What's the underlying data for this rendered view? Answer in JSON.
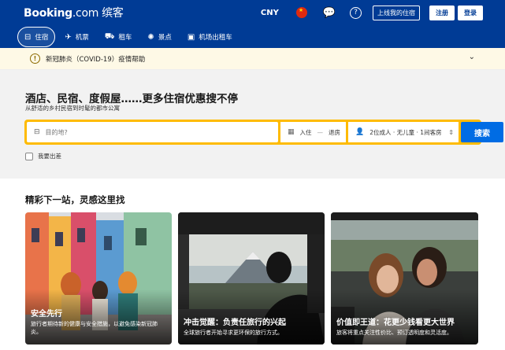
{
  "header": {
    "logo_brand": "Booking",
    "logo_dot": ".com",
    "logo_cn": "缤客",
    "currency": "CNY",
    "list_property": "上线我的住宿",
    "register": "注册",
    "login": "登录"
  },
  "nav": {
    "items": [
      {
        "label": "住宿",
        "icon": "bed-icon",
        "glyph": "🛏"
      },
      {
        "label": "机票",
        "icon": "plane-icon",
        "glyph": "✈"
      },
      {
        "label": "租车",
        "icon": "car-icon",
        "glyph": "🚗"
      },
      {
        "label": "景点",
        "icon": "attraction-icon",
        "glyph": "✺"
      },
      {
        "label": "机场出租车",
        "icon": "taxi-icon",
        "glyph": "▣"
      }
    ]
  },
  "alert": {
    "text": "新冠肺炎（COVID-19）疫情帮助"
  },
  "hero": {
    "title": "酒店、民宿、度假屋……更多住宿优惠搜不停",
    "subtitle": "从舒适的乡村民宿到时髦的都市公寓"
  },
  "search": {
    "destination_placeholder": "目的地?",
    "checkin": "入住",
    "checkout": "退房",
    "occupancy": "2位成人 · 无儿童 · 1间客房",
    "button": "搜索",
    "business_trip": "我要出差"
  },
  "inspiration": {
    "title": "精彩下一站，灵感这里找",
    "cards": [
      {
        "title": "安全先行",
        "desc_line1": "旅行者期待新的健康与安全措施，以避免感染新冠肺",
        "desc_line2": "炎。"
      },
      {
        "title": "冲击觉醒：负责任旅行的兴起",
        "desc_line1": "全球旅行者开始寻求更环保的旅行方式。",
        "desc_line2": ""
      },
      {
        "title": "价值即王道：花更少钱看更大世界",
        "desc_line1": "旅客将重点关注性价比、预订透明度和灵活度。",
        "desc_line2": ""
      }
    ]
  },
  "colors": {
    "brand_blue": "#003b95",
    "search_yellow": "#febb02",
    "button_blue": "#006ce4",
    "alert_bg": "#fef9e6"
  }
}
